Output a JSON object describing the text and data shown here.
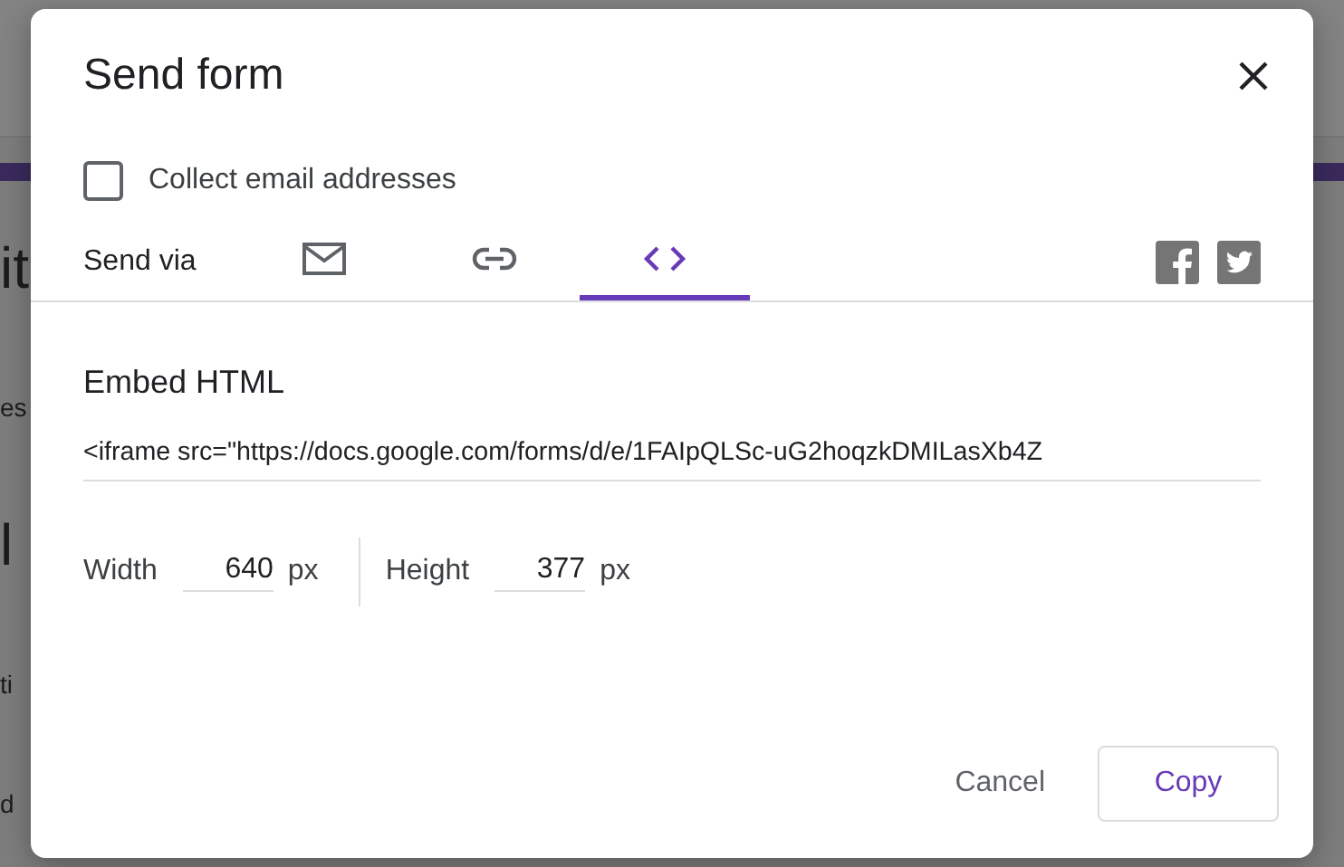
{
  "background": {
    "fragments": [
      {
        "text": "it",
        "kind": "heading"
      },
      {
        "text": "es",
        "kind": "body"
      },
      {
        "text": "l",
        "kind": "heading"
      },
      {
        "text": "ti",
        "kind": "body"
      },
      {
        "text": "d",
        "kind": "body"
      }
    ]
  },
  "dialog": {
    "title": "Send form",
    "collect_email": {
      "label": "Collect email addresses",
      "checked": false
    },
    "send_via": {
      "label": "Send via",
      "tabs": [
        {
          "kind": "email",
          "selected": false
        },
        {
          "kind": "link",
          "selected": false
        },
        {
          "kind": "embed",
          "selected": true
        }
      ],
      "share": [
        {
          "kind": "facebook"
        },
        {
          "kind": "twitter"
        }
      ]
    },
    "embed": {
      "heading": "Embed HTML",
      "code": "<iframe src=\"https://docs.google.com/forms/d/e/1FAIpQLSc-uG2hoqzkDMILasXb4Z",
      "width": {
        "label": "Width",
        "value": "640",
        "unit": "px"
      },
      "height": {
        "label": "Height",
        "value": "377",
        "unit": "px"
      }
    },
    "buttons": [
      {
        "label": "Cancel",
        "kind": "text"
      },
      {
        "label": "Copy",
        "kind": "outlined"
      }
    ]
  }
}
